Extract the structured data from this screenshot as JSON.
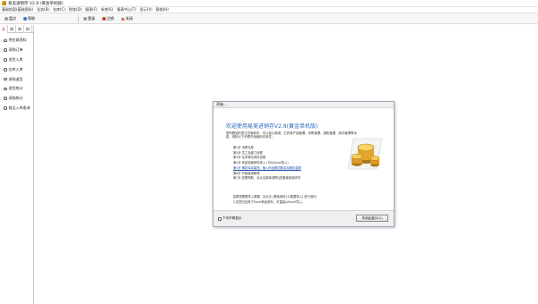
{
  "window": {
    "title": "易美进销存 V2.8 (黄金单机版)"
  },
  "menubar": [
    "基础档案(基础资料)",
    "业务(B)",
    "仓库(C)",
    "财务(D)",
    "报表(F)",
    "系统(S)",
    "报表中心(T)",
    "显示(V)",
    "帮助(H)"
  ],
  "toolbar": {
    "left": [
      {
        "label": "盘点",
        "icon": "gray"
      },
      {
        "label": "帮助",
        "icon": "blue"
      }
    ],
    "right": [
      {
        "label": "登录",
        "icon": "gray"
      },
      {
        "label": "注销",
        "icon": "red"
      },
      {
        "label": "关闭",
        "icon": "redx"
      }
    ]
  },
  "sidebar": {
    "tabs": [
      "采",
      "销",
      "库",
      "财"
    ],
    "items": [
      "供应商资料",
      "采购订单",
      "进货入库",
      "仓库入库",
      "采购退货",
      "进货统计",
      "采购统计",
      "商品入库查询"
    ]
  },
  "dialog": {
    "title": "开始...",
    "welcome": "欢迎使用易美进销存V2.8(黄金单机版)",
    "intro": "您所看到的是正式版软件，可以放心使用，它具有产品管理、采购管理、销售管理、库存管理等功能，请按以下步骤开始使用本软件。",
    "steps": [
      "第1步 设置仓库",
      "第2步 员工及部门设置",
      "第3步 往来单位资料设置",
      "第4步 商品档案资料录入 (可从Excel导入)",
      "第5步 期初库存建账，输入商品期初数量及期初金额",
      "第6步 开始使用管理",
      "第7步 如需帮助，请点击菜单[帮助]查看使用说明书"
    ],
    "link_step_index": 4,
    "footnote": [
      "如果您需要导入数据，请点击 [基础资料]→[数据导入] 进行操作。",
      "2.如您已经有了Excel商品资料，可直接从Excel导入。"
    ],
    "checkbox_label": "下次不再显示",
    "close_label": "关闭此窗口(C)"
  }
}
